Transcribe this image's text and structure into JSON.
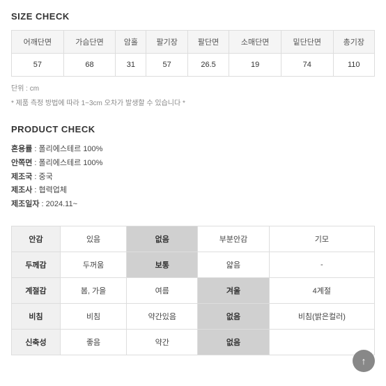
{
  "sizeCheck": {
    "title": "SIZE CHECK",
    "headers": [
      "어깨단면",
      "가슴단면",
      "암홀",
      "팔기장",
      "팔단면",
      "소매단면",
      "밑단단면",
      "총기장"
    ],
    "values": [
      "57",
      "68",
      "31",
      "57",
      "26.5",
      "19",
      "74",
      "110"
    ],
    "unitNote": "단위 : cm",
    "measureNote": "* 제품 측정 방법에 따라 1~3cm 오차가 발생할 수 있습니다 *"
  },
  "productCheck": {
    "title": "PRODUCT CHECK",
    "infoLines": [
      {
        "label": "혼용률",
        "value": "폴리에스테르 100%"
      },
      {
        "label": "안쪽면",
        "value": "폴리에스테르 100%"
      },
      {
        "label": "제조국",
        "value": "중국"
      },
      {
        "label": "제조사",
        "value": "협력업체"
      },
      {
        "label": "제조일자",
        "value": "2024.11~"
      }
    ],
    "checkGrid": [
      {
        "label": "안감",
        "options": [
          {
            "text": "있음",
            "highlighted": false
          },
          {
            "text": "없음",
            "highlighted": true
          },
          {
            "text": "부분안감",
            "highlighted": false
          },
          {
            "text": "기모",
            "highlighted": false
          }
        ]
      },
      {
        "label": "두께감",
        "options": [
          {
            "text": "두꺼움",
            "highlighted": false
          },
          {
            "text": "보통",
            "highlighted": true
          },
          {
            "text": "얇음",
            "highlighted": false
          },
          {
            "text": "-",
            "highlighted": false
          }
        ]
      },
      {
        "label": "계절감",
        "options": [
          {
            "text": "봄, 가을",
            "highlighted": false
          },
          {
            "text": "여름",
            "highlighted": false
          },
          {
            "text": "겨울",
            "highlighted": true
          },
          {
            "text": "4계절",
            "highlighted": false
          }
        ]
      },
      {
        "label": "비침",
        "options": [
          {
            "text": "비침",
            "highlighted": false
          },
          {
            "text": "약간있음",
            "highlighted": false
          },
          {
            "text": "없음",
            "highlighted": true
          },
          {
            "text": "비침(밝은컬러)",
            "highlighted": false
          }
        ]
      },
      {
        "label": "신축성",
        "options": [
          {
            "text": "좋음",
            "highlighted": false
          },
          {
            "text": "약간",
            "highlighted": false
          },
          {
            "text": "없음",
            "highlighted": true
          },
          {
            "text": "",
            "highlighted": false
          }
        ]
      }
    ]
  },
  "scrollTopBtn": {
    "icon": "↑"
  }
}
